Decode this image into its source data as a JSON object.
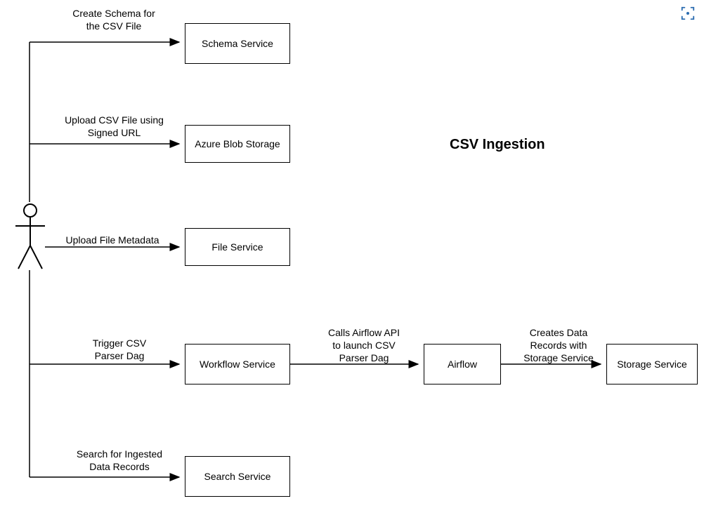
{
  "title": "CSV Ingestion",
  "actor": {
    "name": "User"
  },
  "boxes": {
    "schema_service": "Schema Service",
    "azure_blob": "Azure Blob Storage",
    "file_service": "File Service",
    "workflow_service": "Workflow Service",
    "airflow": "Airflow",
    "storage_service": "Storage Service",
    "search_service": "Search Service"
  },
  "edges": {
    "create_schema_1": "Create Schema for",
    "create_schema_2": "the CSV File",
    "upload_csv_1": "Upload CSV File using",
    "upload_csv_2": "Signed URL",
    "upload_metadata": "Upload File Metadata",
    "trigger_csv_1": "Trigger CSV",
    "trigger_csv_2": "Parser Dag",
    "calls_airflow_1": "Calls Airflow API",
    "calls_airflow_2": "to launch CSV",
    "calls_airflow_3": "Parser Dag",
    "creates_data_1": "Creates Data",
    "creates_data_2": "Records with",
    "creates_data_3": "Storage Service",
    "search_1": "Search for Ingested",
    "search_2": "Data Records"
  },
  "icon": {
    "name": "scan-icon"
  }
}
